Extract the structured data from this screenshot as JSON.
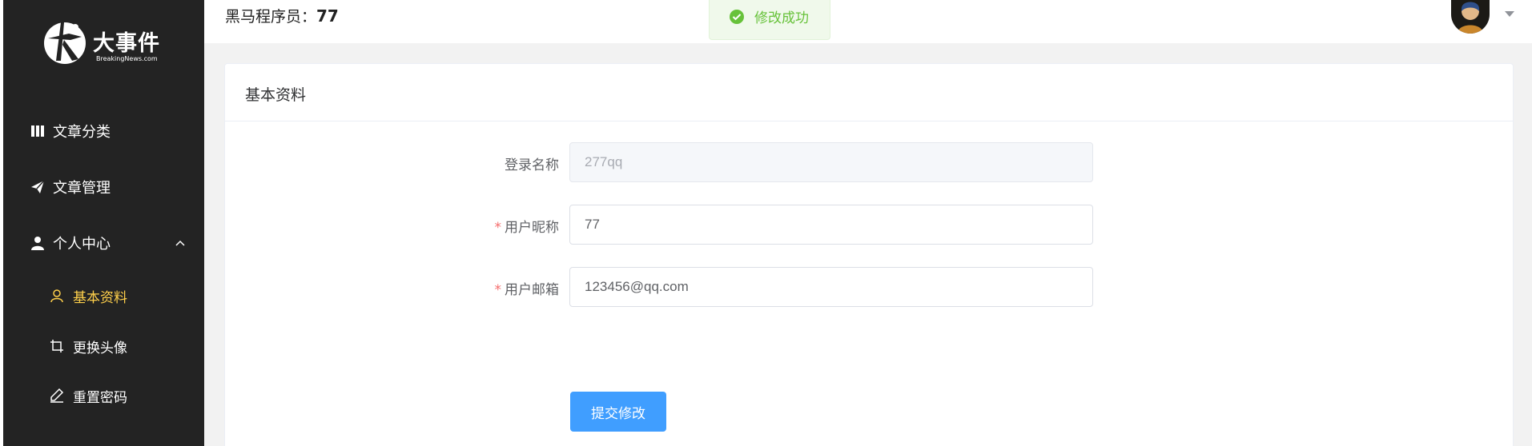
{
  "app": {
    "brand_name": "大事件",
    "brand_sub": "BreakingNews.com"
  },
  "header": {
    "title_prefix": "黑马程序员：",
    "nickname": "77"
  },
  "toast": {
    "message": "修改成功",
    "color": "#67c23a"
  },
  "sidebar": {
    "items": [
      {
        "label": "文章分类",
        "icon": "book-icon"
      },
      {
        "label": "文章管理",
        "icon": "paper-plane-icon"
      },
      {
        "label": "个人中心",
        "icon": "user-icon",
        "expanded": true
      }
    ],
    "sub_items": [
      {
        "label": "基本资料",
        "icon": "user-outline-icon",
        "active": true
      },
      {
        "label": "更换头像",
        "icon": "crop-icon"
      },
      {
        "label": "重置密码",
        "icon": "edit-pen-icon"
      }
    ],
    "active_color": "#ffd04b",
    "bg_color": "#232323"
  },
  "card": {
    "title": "基本资料"
  },
  "form": {
    "login_name_label": "登录名称",
    "login_name_value": "277qq",
    "nickname_label": "用户昵称",
    "nickname_value": "77",
    "email_label": "用户邮箱",
    "email_value": "123456@qq.com",
    "required_mark": "*",
    "submit_label": "提交修改"
  },
  "colors": {
    "primary": "#409eff",
    "required": "#f56c6c"
  }
}
